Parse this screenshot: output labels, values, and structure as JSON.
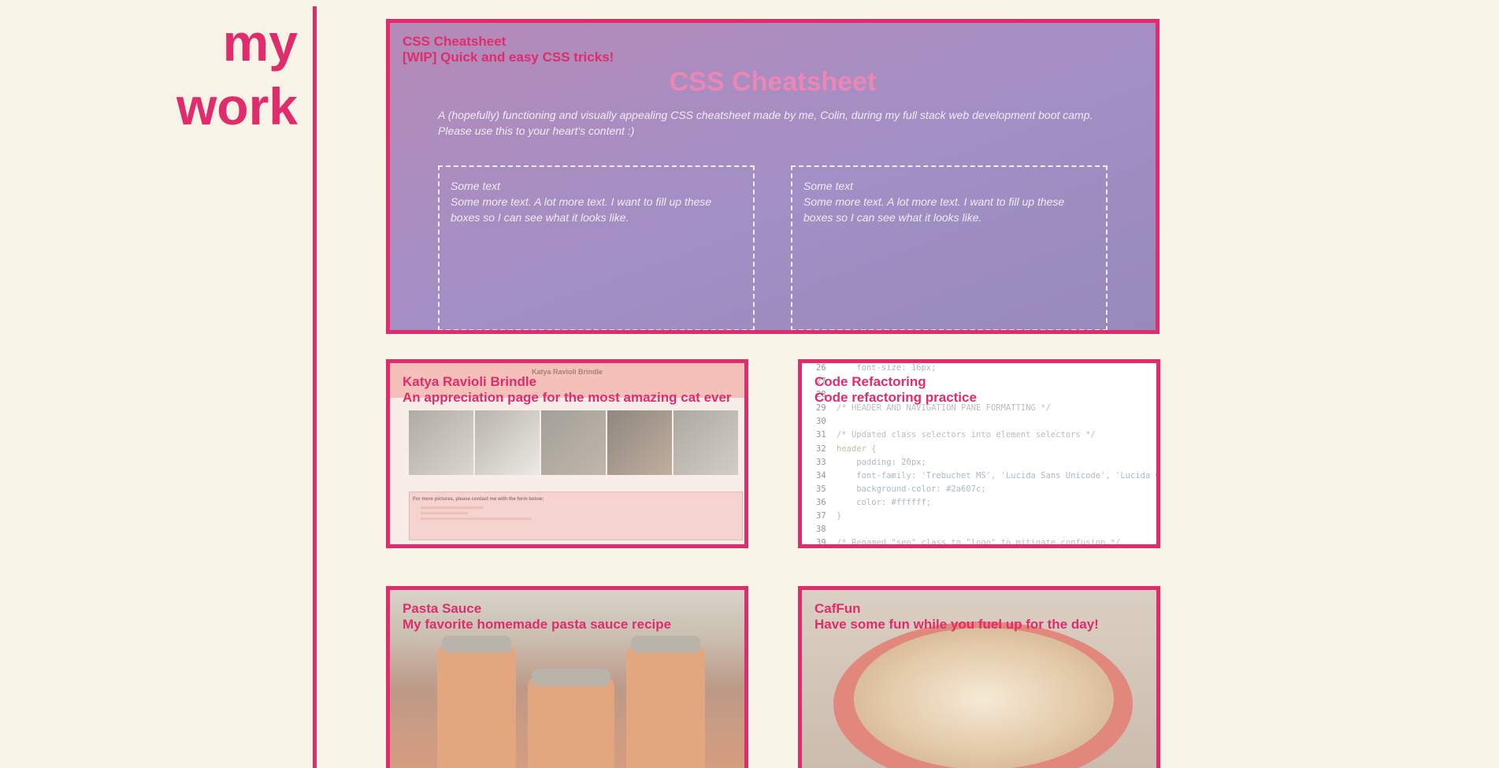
{
  "heading": {
    "line1": "my",
    "line2": "work"
  },
  "colors": {
    "accent": "#e02c6d",
    "background": "#f7f4e7"
  },
  "projects": [
    {
      "title": "CSS Cheatsheet",
      "subtitle": "[WIP] Quick and easy CSS tricks!",
      "preview": {
        "heading": "CSS Cheatsheet",
        "description_line1": "A (hopefully) functioning and visually appealing CSS cheatsheet made by me, Colin, during my full stack web development boot camp.",
        "description_line2": "Please use this to your heart's content :)",
        "boxes": [
          {
            "label": "Some text",
            "body": "Some more text. A lot more text. I want to fill up these boxes so I can see what it looks like."
          },
          {
            "label": "Some text",
            "body": "Some more text. A lot more text. I want to fill up these boxes so I can see what it looks like."
          }
        ]
      }
    },
    {
      "title": "Katya Ravioli Brindle",
      "subtitle": "An appreciation page for the most amazing cat ever",
      "preview": {
        "name": "Katya Ravioli Brindle",
        "form_title": "For more pictures, please contact me with the form below:"
      }
    },
    {
      "title": "Code Refactoring",
      "subtitle": "Code refactoring practice",
      "preview": {
        "code_lines": [
          {
            "n": "26",
            "text": "    font-size: 16px;"
          },
          {
            "n": "27",
            "text": "}"
          },
          {
            "n": "28",
            "text": ""
          },
          {
            "n": "29",
            "text": "/* HEADER AND NAVIGATION PANE FORMATTING */"
          },
          {
            "n": "30",
            "text": ""
          },
          {
            "n": "31",
            "text": "/* Updated class selectors into element selectors */"
          },
          {
            "n": "32",
            "text": "header {"
          },
          {
            "n": "33",
            "text": "    padding: 20px;"
          },
          {
            "n": "34",
            "text": "    font-family: 'Trebuchet MS', 'Lucida Sans Unicode', 'Lucida G"
          },
          {
            "n": "35",
            "text": "    background-color: #2a607c;"
          },
          {
            "n": "36",
            "text": "    color: #ffffff;"
          },
          {
            "n": "37",
            "text": "}"
          },
          {
            "n": "38",
            "text": ""
          },
          {
            "n": "39",
            "text": "/* Renamed \"seo\" class to \"logo\" to mitigate confusion */"
          }
        ]
      }
    },
    {
      "title": "Pasta Sauce",
      "subtitle": "My favorite homemade pasta sauce recipe"
    },
    {
      "title": "CafFun",
      "subtitle": "Have some fun while you fuel up for the day!"
    }
  ]
}
